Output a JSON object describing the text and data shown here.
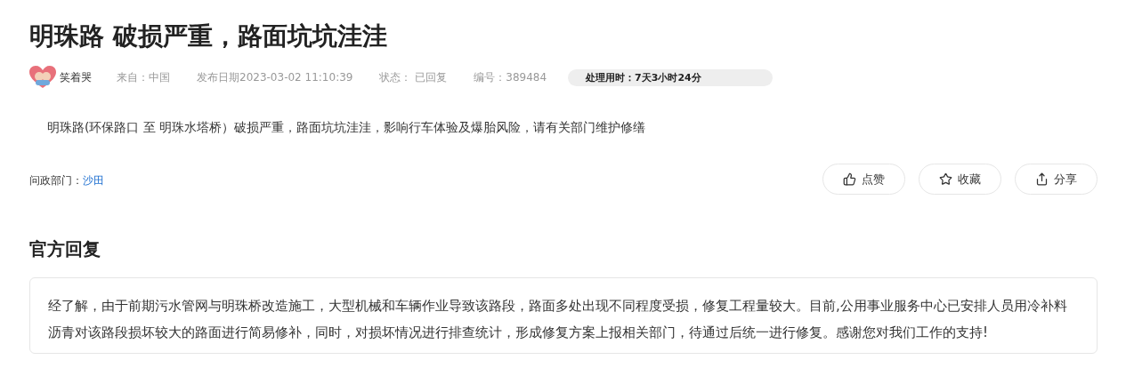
{
  "title": "明珠路 破损严重，路面坑坑洼洼",
  "meta": {
    "user": "笑着哭",
    "source": "来自：中国",
    "date": "发布日期2023-03-02 11:10:39",
    "status": "状态： 已回复",
    "number": "编号：389484",
    "duration": "处理用时：7天3小时24分"
  },
  "content": "明珠路(环保路口 至 明珠水塔桥）破损严重，路面坑坑洼洼，影响行车体验及爆胎风险，请有关部门维护修缮",
  "department": {
    "label": "问政部门：",
    "name": "沙田"
  },
  "actions": [
    {
      "kind": "like",
      "label": "点赞"
    },
    {
      "kind": "star",
      "label": "收藏"
    },
    {
      "kind": "share",
      "label": "分享"
    }
  ],
  "reply": {
    "heading": "官方回复",
    "text": "经了解，由于前期污水管网与明珠桥改造施工，大型机械和车辆作业导致该路段，路面多处出现不同程度受损，修复工程量较大。目前,公用事业服务中心已安排人员用冷补料沥青对该路段损坏较大的路面进行简易修补，同时，对损坏情况进行排查统计，形成修复方案上报相关部门，待通过后统一进行修复。感谢您对我们工作的支持!"
  }
}
